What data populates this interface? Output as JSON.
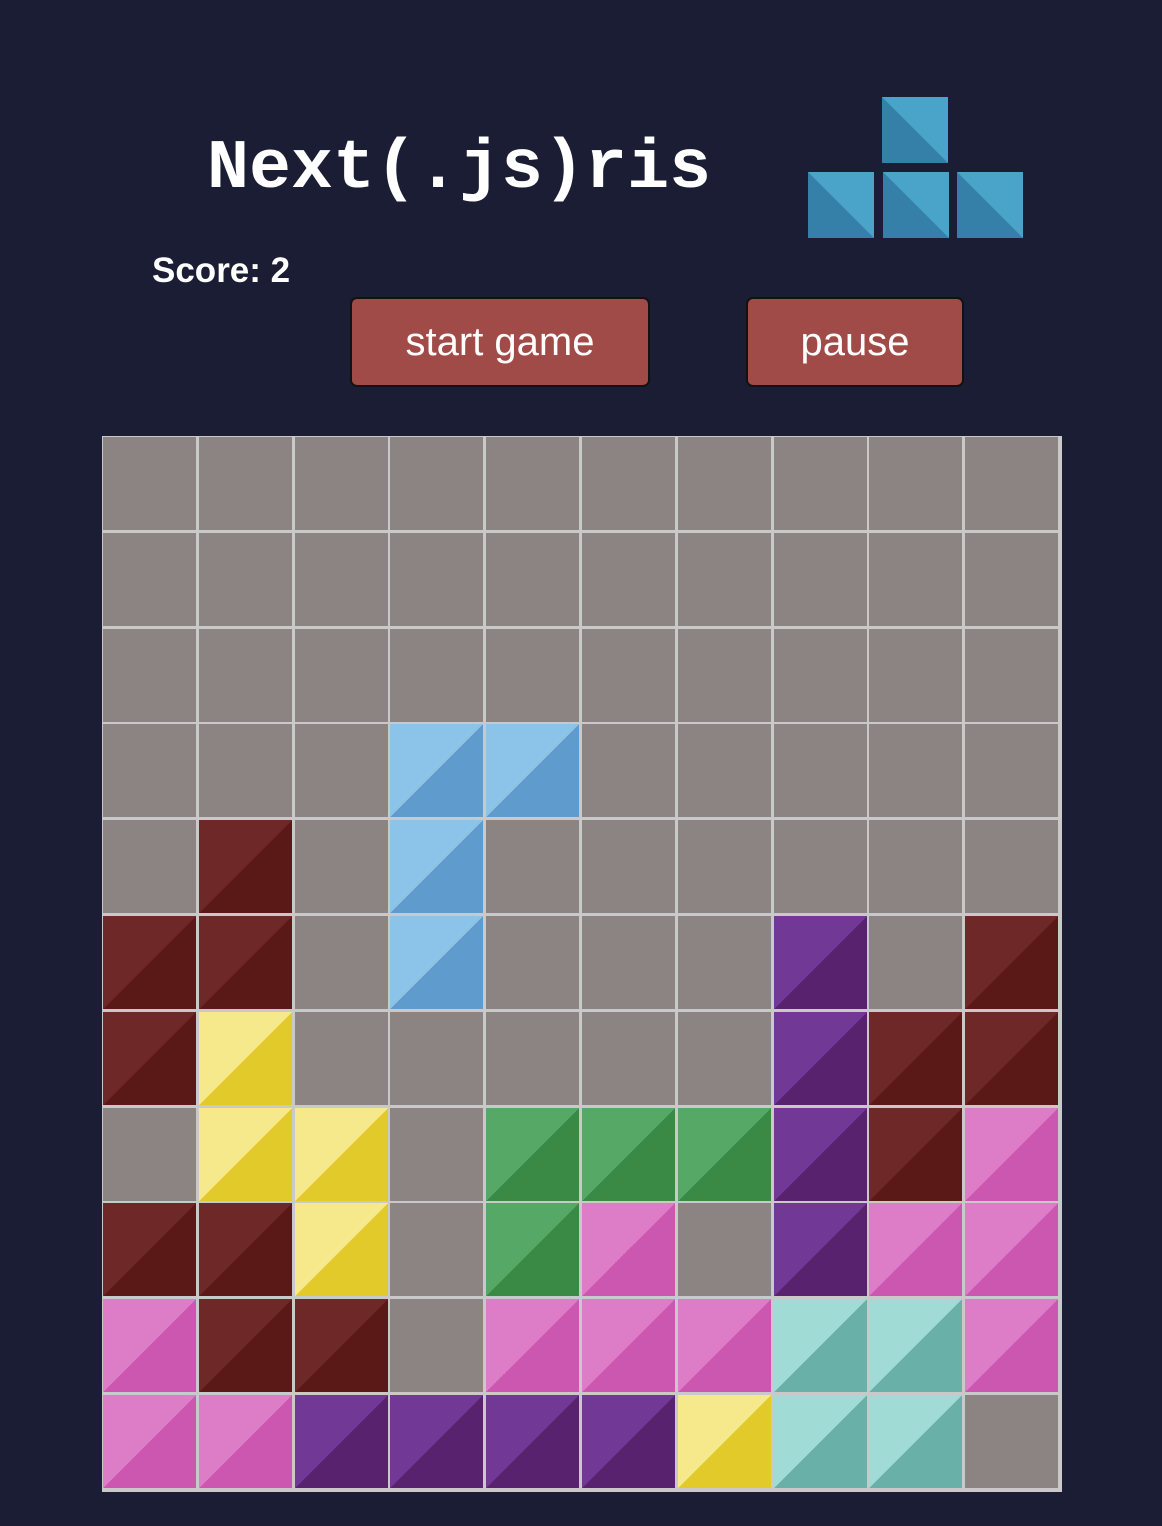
{
  "app": {
    "title": "Next(.js)ris",
    "score_text": "Score: 2"
  },
  "controls": {
    "start_label": "start game",
    "pause_label": "pause"
  },
  "colors": {
    "background": "#1a1d33",
    "button": "#a04b47",
    "logo_block": "#4aa3c9"
  },
  "logo": {
    "icon": "t-tetromino-icon"
  },
  "board": {
    "columns": 10,
    "rows": 11,
    "legend": {
      ".": "empty",
      "B": "light-blue",
      "R": "dark-red",
      "U": "purple",
      "Y": "yellow",
      "G": "green",
      "P": "pink",
      "T": "teal"
    },
    "palette": {
      "empty": "#8c8482",
      "light-blue": [
        "#8cc3e9",
        "#5f9ccd"
      ],
      "dark-red": [
        "#6e2827",
        "#5a1816"
      ],
      "purple": [
        "#713896",
        "#58226f"
      ],
      "yellow": [
        "#f5e98c",
        "#e3ca2b"
      ],
      "green": [
        "#55a866",
        "#3a8944"
      ],
      "pink": [
        "#dd7cc7",
        "#cb57b0"
      ],
      "teal": [
        "#a1dbd5",
        "#68b0a8"
      ]
    },
    "grid": [
      "..........",
      "..........",
      "..........",
      "...BB.....",
      ".R.B......",
      "RR.B...U.R",
      "RY.....URR",
      ".YY.GGGURP",
      "RRY.GP.UPP",
      "PRR.PPPTTP",
      "PPUUUUYTT."
    ]
  }
}
